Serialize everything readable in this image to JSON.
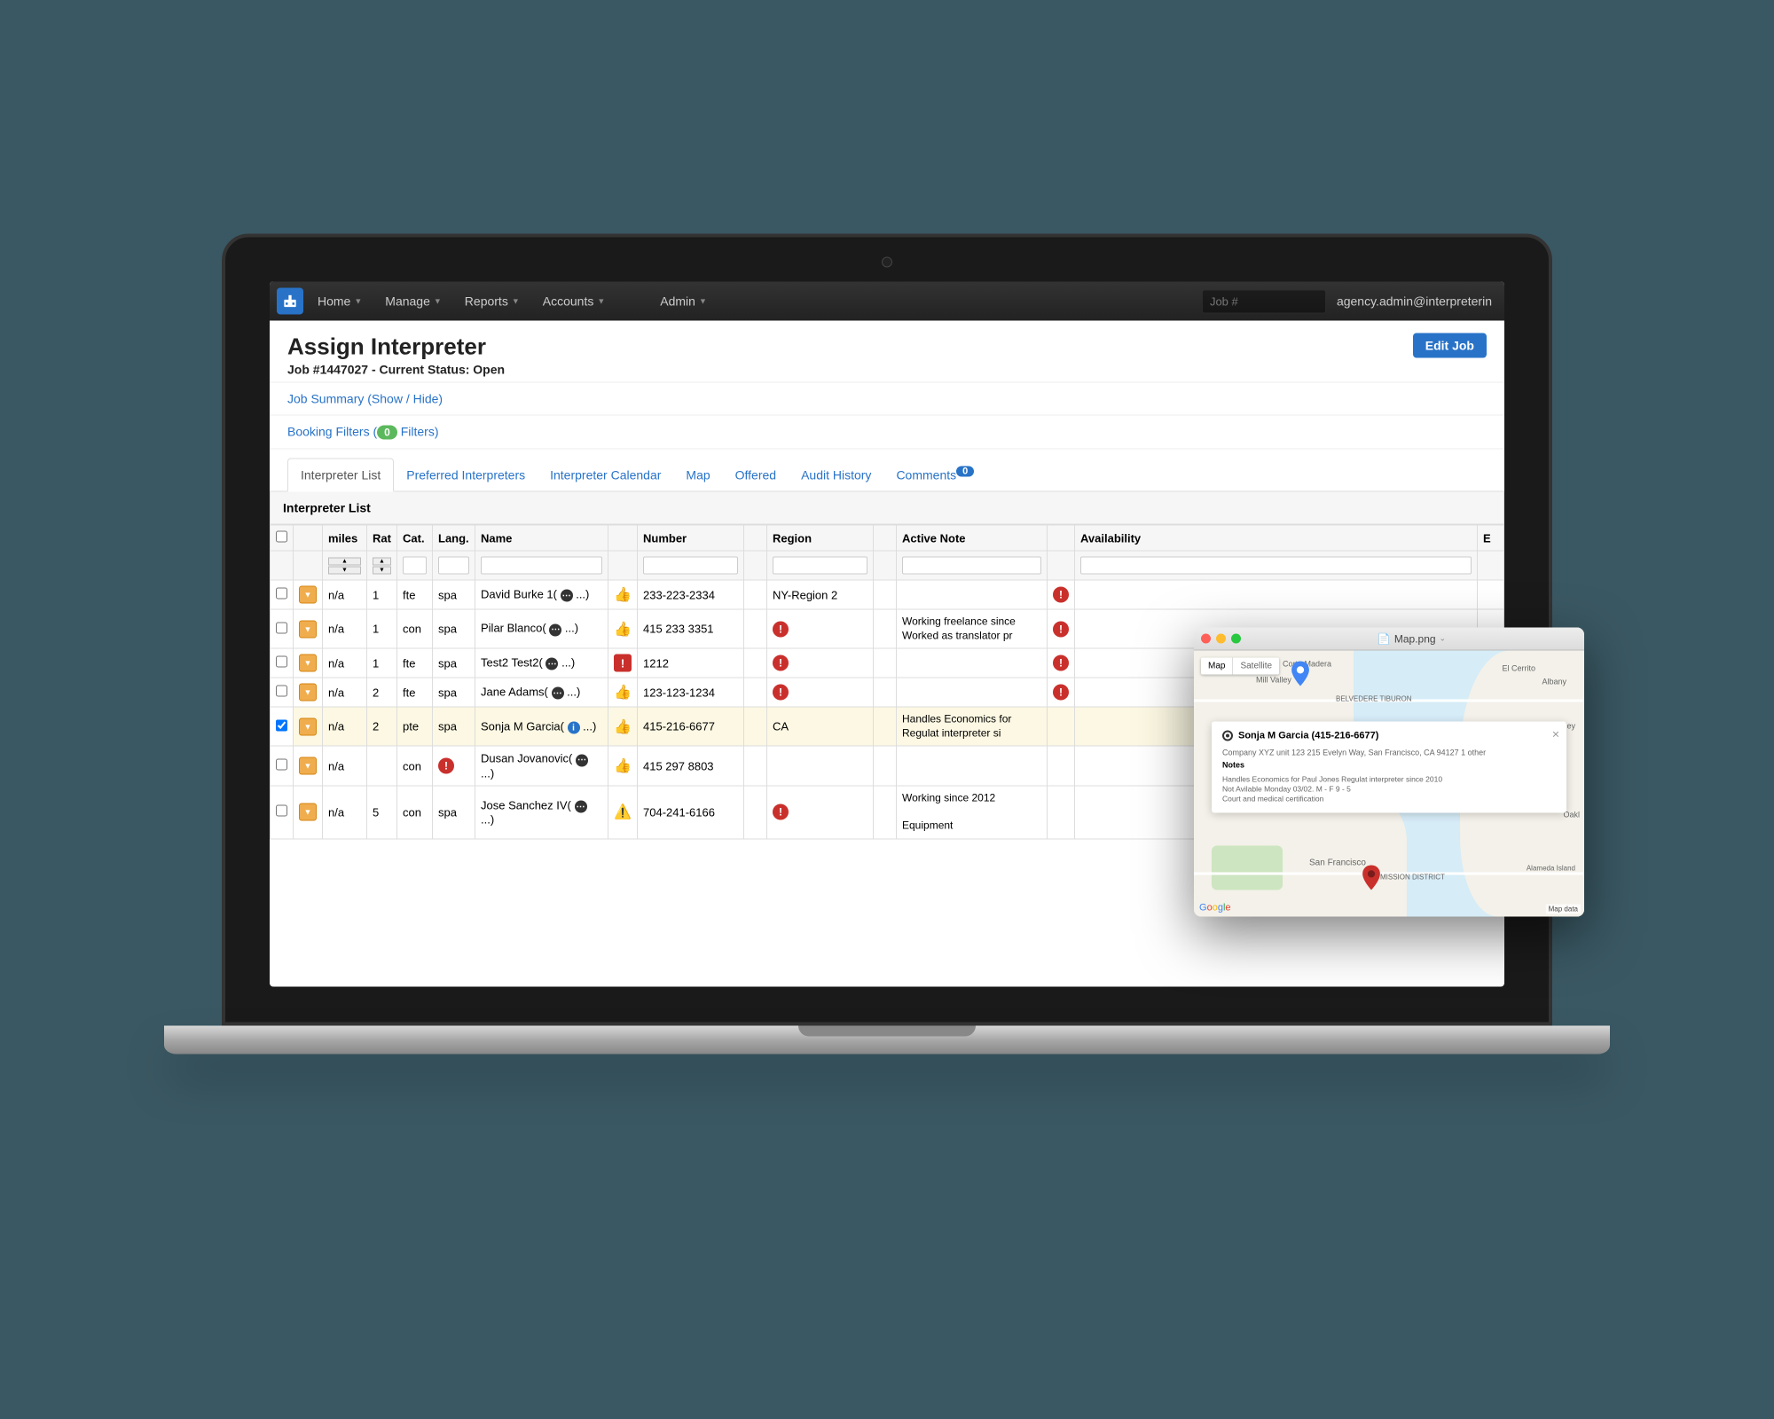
{
  "nav": {
    "items": [
      "Home",
      "Manage",
      "Reports",
      "Accounts",
      "Admin"
    ],
    "search_placeholder": "Job #",
    "user": "agency.admin@interpreterin"
  },
  "page": {
    "title": "Assign Interpreter",
    "subtitle": "Job #1447027 - Current Status: Open",
    "edit_btn": "Edit Job"
  },
  "toggles": {
    "summary": "Job Summary (Show / Hide)",
    "filters_pre": "Booking Filters (",
    "filters_count": "0",
    "filters_post": " Filters)"
  },
  "tabs": [
    {
      "label": "Interpreter List",
      "active": true
    },
    {
      "label": "Preferred Interpreters"
    },
    {
      "label": "Interpreter Calendar"
    },
    {
      "label": "Map"
    },
    {
      "label": "Offered"
    },
    {
      "label": "Audit History"
    },
    {
      "label": "Comments",
      "badge": "0"
    }
  ],
  "panel_title": "Interpreter List",
  "columns": [
    "",
    "",
    "miles",
    "Rat",
    "Cat.",
    "Lang.",
    "Name",
    "",
    "Number",
    "",
    "Region",
    "",
    "Active Note",
    "",
    "Availability",
    "E"
  ],
  "rows": [
    {
      "checked": false,
      "miles": "n/a",
      "rate": "1",
      "cat": "fte",
      "lang": "spa",
      "name": "David Burke 1( ",
      "icon": "thumb",
      "number": "233-223-2334",
      "region": "NY-Region 2",
      "region_alert": false,
      "note": "",
      "note_alert": true
    },
    {
      "checked": false,
      "miles": "n/a",
      "rate": "1",
      "cat": "con",
      "lang": "spa",
      "name": "Pilar Blanco( ",
      "icon": "thumb",
      "number": "415 233 3351",
      "region": "",
      "region_alert": true,
      "note": "Working freelance since\nWorked as translator pr",
      "note_alert": true
    },
    {
      "checked": false,
      "miles": "n/a",
      "rate": "1",
      "cat": "fte",
      "lang": "spa",
      "name": "Test2 Test2( ",
      "icon": "alert-square",
      "number": "1212",
      "region": "",
      "region_alert": true,
      "note": "",
      "note_alert": true
    },
    {
      "checked": false,
      "miles": "n/a",
      "rate": "2",
      "cat": "fte",
      "lang": "spa",
      "name": "Jane Adams( ",
      "icon": "thumb",
      "number": "123-123-1234",
      "region": "",
      "region_alert": true,
      "note": "",
      "note_alert": true
    },
    {
      "checked": true,
      "highlight": true,
      "miles": "n/a",
      "rate": "2",
      "cat": "pte",
      "lang": "spa",
      "name": "Sonja M Garcia( ",
      "name_info": true,
      "icon": "thumb",
      "number": "415-216-6677",
      "region": "CA",
      "region_alert": false,
      "note": "Handles Economics for\nRegulat interpreter si",
      "note_alert": false
    },
    {
      "checked": false,
      "miles": "n/a",
      "rate": "",
      "cat": "con",
      "lang": "",
      "lang_alert": true,
      "name": "Dusan Jovanovic( ",
      "icon": "thumb",
      "number": "415 297 8803",
      "region": "",
      "region_alert": false,
      "note": "",
      "note_alert": false
    },
    {
      "checked": false,
      "miles": "n/a",
      "rate": "5",
      "cat": "con",
      "lang": "spa",
      "name": "Jose Sanchez IV( ",
      "icon": "warn",
      "number": "704-241-6166",
      "region": "",
      "region_alert": true,
      "note": "Working since 2012\n\nEquipment",
      "note_alert": false
    }
  ],
  "more_suffix": " ...)",
  "mapwin": {
    "title": "Map.png",
    "map_btn": "Map",
    "sat_btn": "Satellite",
    "info_title": "Sonja M Garcia (415-216-6677)",
    "address": "Company XYZ unit 123 215 Evelyn Way, San Francisco, CA 94127 1 other",
    "notes_label": "Notes",
    "note1": "Handles Economics for Paul Jones Regulat interpreter since 2010",
    "note2": "Not Avilable Monday 03/02. M - F 9 - 5",
    "note3": "Court and medical certification",
    "attr": "Map data",
    "places": {
      "corte": "Corte Madera",
      "mill": "Mill Valley",
      "belv": "BELVEDERE TIBURON",
      "alb": "Albany",
      "berk": "Berkeley",
      "elc": "El Cerrito",
      "sf": "San Francisco",
      "mission": "MISSION DISTRICT",
      "oak": "Oakl",
      "alam": "Alameda Island"
    }
  }
}
